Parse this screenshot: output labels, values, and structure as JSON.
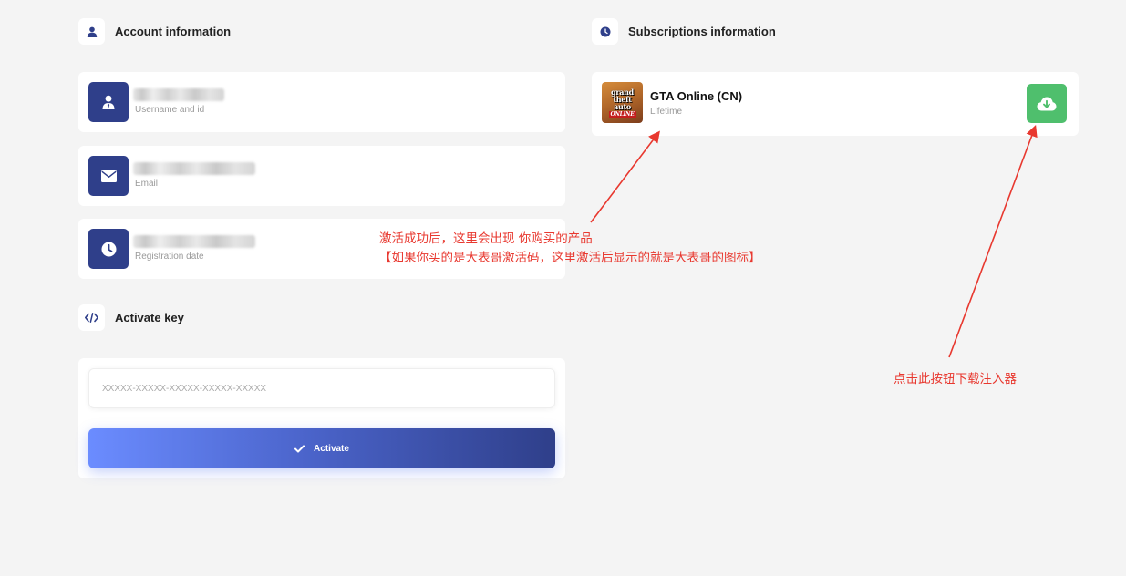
{
  "account": {
    "title": "Account information",
    "fields": [
      {
        "label": "Username and id",
        "value": "",
        "icon": "user-tie-icon"
      },
      {
        "label": "Email",
        "value": "",
        "icon": "envelope-icon"
      },
      {
        "label": "Registration date",
        "value": "",
        "icon": "clock-icon"
      }
    ]
  },
  "subscriptions": {
    "title": "Subscriptions information",
    "items": [
      {
        "name": "GTA Online (CN)",
        "status": "Lifetime",
        "icon": "gta-game-icon",
        "logo_text": [
          "grand",
          "theft",
          "auto"
        ],
        "logo_badge": "ONLINE"
      }
    ],
    "download_icon": "cloud-download-icon"
  },
  "activate": {
    "title": "Activate key",
    "placeholder": "XXXXX-XXXXX-XXXXX-XXXXX-XXXXX",
    "button_label": "Activate"
  },
  "annotations": {
    "product_note_line1": "激活成功后，这里会出现 你购买的产品",
    "product_note_line2": "【如果你买的是大表哥激活码，这里激活后显示的就是大表哥的图标】",
    "download_note": "点击此按钮下载注入器"
  },
  "colors": {
    "background": "#f4f4f4",
    "primary": "#2f3f8a",
    "primary_light": "#6b8cff",
    "success": "#4fbf6d",
    "annotation": "#e8382f"
  }
}
